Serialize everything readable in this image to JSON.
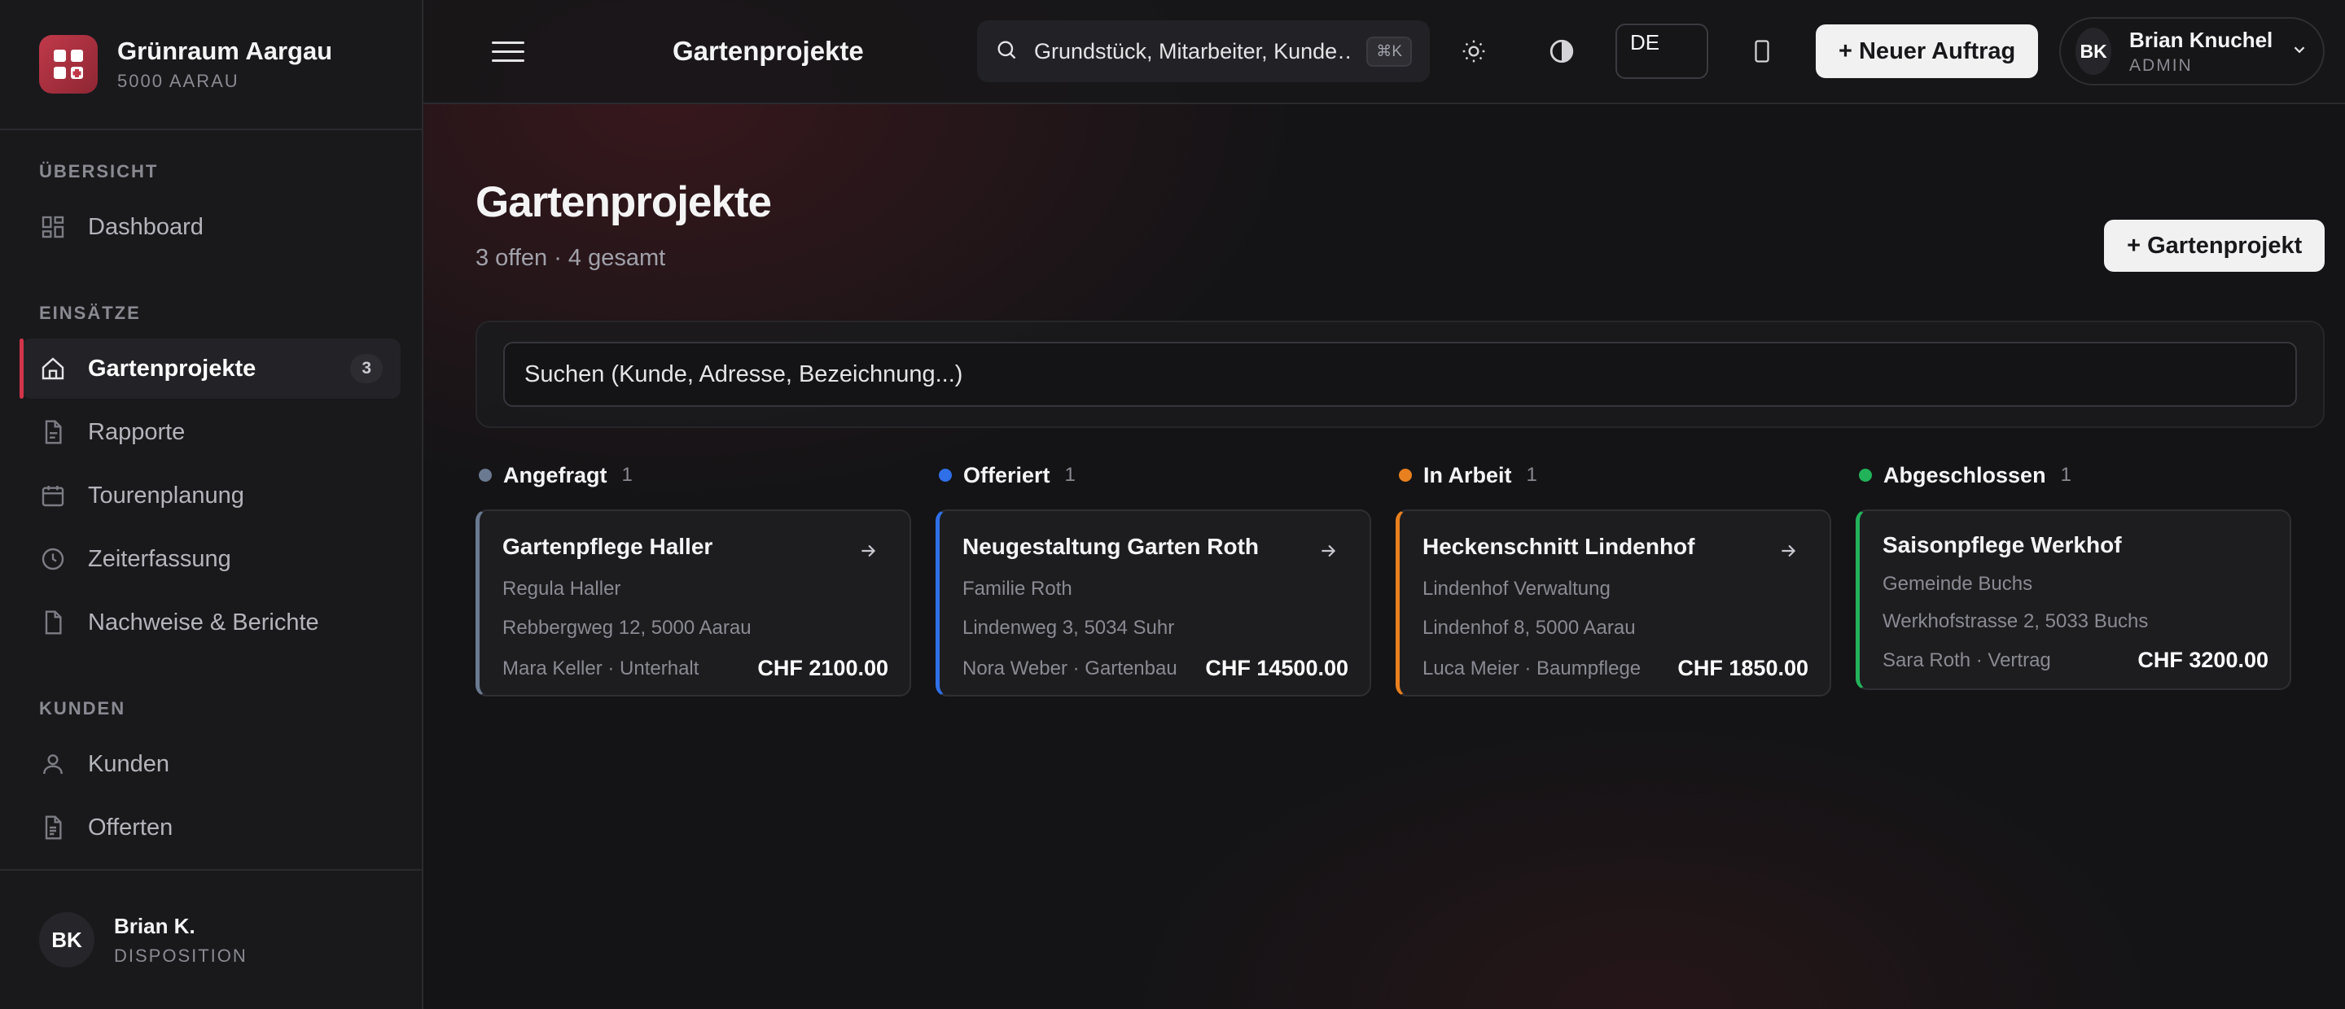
{
  "brand": {
    "name": "Grünraum Aargau",
    "sub": "5000 AARAU"
  },
  "sidebar": {
    "sections": [
      {
        "label": "ÜBERSICHT",
        "items": [
          {
            "label": "Dashboard",
            "icon": "grid-icon"
          }
        ]
      },
      {
        "label": "EINSÄTZE",
        "items": [
          {
            "label": "Gartenprojekte",
            "icon": "home-icon",
            "badge": "3",
            "active": true
          },
          {
            "label": "Rapporte",
            "icon": "file-text-icon"
          },
          {
            "label": "Tourenplanung",
            "icon": "calendar-icon"
          },
          {
            "label": "Zeiterfassung",
            "icon": "clock-icon"
          },
          {
            "label": "Nachweise & Berichte",
            "icon": "file-icon"
          }
        ]
      },
      {
        "label": "KUNDEN",
        "items": [
          {
            "label": "Kunden",
            "icon": "user-icon"
          },
          {
            "label": "Offerten",
            "icon": "document-icon"
          }
        ]
      }
    ],
    "user": {
      "initials": "BK",
      "name": "Brian K.",
      "role": "DISPOSITION"
    }
  },
  "topbar": {
    "title": "Gartenprojekte",
    "search_text": "Grundstück, Mitarbeiter, Kunde…",
    "shortcut": "⌘K",
    "language": "DE",
    "new_order_label": "+ Neuer Auftrag",
    "user": {
      "initials": "BK",
      "name": "Brian Knuchel",
      "role": "ADMIN"
    }
  },
  "page": {
    "title": "Gartenprojekte",
    "subtitle": "3 offen · 4 gesamt",
    "add_label": "+ Gartenprojekt",
    "filter_placeholder": "Suchen (Kunde, Adresse, Bezeichnung...)"
  },
  "colors": {
    "accent": "#d0354a",
    "angefragt": "#6b7a90",
    "offeriert": "#2f6fe8",
    "in_arbeit": "#e8801f",
    "abgeschlossen": "#22b35a"
  },
  "board": {
    "columns": [
      {
        "title": "Angefragt",
        "count": "1",
        "card": {
          "title": "Gartenpflege Haller",
          "client": "Regula Haller",
          "address": "Rebbergweg 12, 5000 Aarau",
          "meta": "Mara Keller · Unterhalt",
          "amount": "CHF 2100.00"
        }
      },
      {
        "title": "Offeriert",
        "count": "1",
        "card": {
          "title": "Neugestaltung Garten Roth",
          "client": "Familie Roth",
          "address": "Lindenweg 3, 5034 Suhr",
          "meta": "Nora Weber · Gartenbau",
          "amount": "CHF 14500.00"
        }
      },
      {
        "title": "In Arbeit",
        "count": "1",
        "card": {
          "title": "Heckenschnitt Lindenhof",
          "client": "Lindenhof Verwaltung",
          "address": "Lindenhof 8, 5000 Aarau",
          "meta": "Luca Meier · Baumpflege",
          "amount": "CHF 1850.00"
        }
      },
      {
        "title": "Abgeschlossen",
        "count": "1",
        "card": {
          "title": "Saisonpflege Werkhof",
          "client": "Gemeinde Buchs",
          "address": "Werkhofstrasse 2, 5033 Buchs",
          "meta": "Sara Roth · Vertrag",
          "amount": "CHF 3200.00"
        }
      }
    ]
  }
}
